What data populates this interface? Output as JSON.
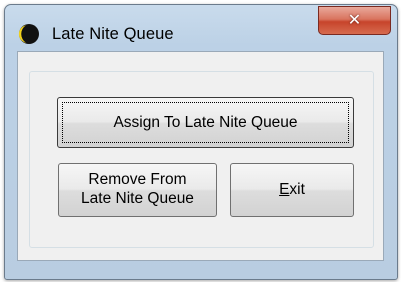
{
  "window": {
    "title": "Late Nite Queue",
    "close_label": "✕",
    "icon": "moon-icon"
  },
  "buttons": {
    "assign_label": "Assign To Late Nite Queue",
    "remove_line1": "Remove From",
    "remove_line2": "Late Nite Queue",
    "exit_mnemonic": "E",
    "exit_rest": "xit"
  },
  "colors": {
    "titlebar": "#bcd1e6",
    "close_button": "#c7442b",
    "client_background": "#f0f0f0",
    "moon_icon": "#f2d21c"
  }
}
